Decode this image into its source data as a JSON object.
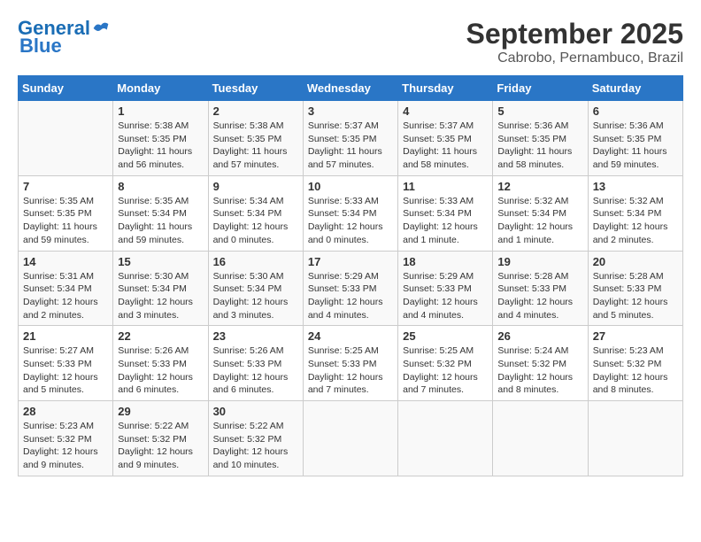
{
  "logo": {
    "line1": "General",
    "line2": "Blue"
  },
  "title": "September 2025",
  "subtitle": "Cabrobo, Pernambuco, Brazil",
  "weekdays": [
    "Sunday",
    "Monday",
    "Tuesday",
    "Wednesday",
    "Thursday",
    "Friday",
    "Saturday"
  ],
  "weeks": [
    [
      {
        "day": "",
        "info": ""
      },
      {
        "day": "1",
        "info": "Sunrise: 5:38 AM\nSunset: 5:35 PM\nDaylight: 11 hours\nand 56 minutes."
      },
      {
        "day": "2",
        "info": "Sunrise: 5:38 AM\nSunset: 5:35 PM\nDaylight: 11 hours\nand 57 minutes."
      },
      {
        "day": "3",
        "info": "Sunrise: 5:37 AM\nSunset: 5:35 PM\nDaylight: 11 hours\nand 57 minutes."
      },
      {
        "day": "4",
        "info": "Sunrise: 5:37 AM\nSunset: 5:35 PM\nDaylight: 11 hours\nand 58 minutes."
      },
      {
        "day": "5",
        "info": "Sunrise: 5:36 AM\nSunset: 5:35 PM\nDaylight: 11 hours\nand 58 minutes."
      },
      {
        "day": "6",
        "info": "Sunrise: 5:36 AM\nSunset: 5:35 PM\nDaylight: 11 hours\nand 59 minutes."
      }
    ],
    [
      {
        "day": "7",
        "info": "Sunrise: 5:35 AM\nSunset: 5:35 PM\nDaylight: 11 hours\nand 59 minutes."
      },
      {
        "day": "8",
        "info": "Sunrise: 5:35 AM\nSunset: 5:34 PM\nDaylight: 11 hours\nand 59 minutes."
      },
      {
        "day": "9",
        "info": "Sunrise: 5:34 AM\nSunset: 5:34 PM\nDaylight: 12 hours\nand 0 minutes."
      },
      {
        "day": "10",
        "info": "Sunrise: 5:33 AM\nSunset: 5:34 PM\nDaylight: 12 hours\nand 0 minutes."
      },
      {
        "day": "11",
        "info": "Sunrise: 5:33 AM\nSunset: 5:34 PM\nDaylight: 12 hours\nand 1 minute."
      },
      {
        "day": "12",
        "info": "Sunrise: 5:32 AM\nSunset: 5:34 PM\nDaylight: 12 hours\nand 1 minute."
      },
      {
        "day": "13",
        "info": "Sunrise: 5:32 AM\nSunset: 5:34 PM\nDaylight: 12 hours\nand 2 minutes."
      }
    ],
    [
      {
        "day": "14",
        "info": "Sunrise: 5:31 AM\nSunset: 5:34 PM\nDaylight: 12 hours\nand 2 minutes."
      },
      {
        "day": "15",
        "info": "Sunrise: 5:30 AM\nSunset: 5:34 PM\nDaylight: 12 hours\nand 3 minutes."
      },
      {
        "day": "16",
        "info": "Sunrise: 5:30 AM\nSunset: 5:34 PM\nDaylight: 12 hours\nand 3 minutes."
      },
      {
        "day": "17",
        "info": "Sunrise: 5:29 AM\nSunset: 5:33 PM\nDaylight: 12 hours\nand 4 minutes."
      },
      {
        "day": "18",
        "info": "Sunrise: 5:29 AM\nSunset: 5:33 PM\nDaylight: 12 hours\nand 4 minutes."
      },
      {
        "day": "19",
        "info": "Sunrise: 5:28 AM\nSunset: 5:33 PM\nDaylight: 12 hours\nand 4 minutes."
      },
      {
        "day": "20",
        "info": "Sunrise: 5:28 AM\nSunset: 5:33 PM\nDaylight: 12 hours\nand 5 minutes."
      }
    ],
    [
      {
        "day": "21",
        "info": "Sunrise: 5:27 AM\nSunset: 5:33 PM\nDaylight: 12 hours\nand 5 minutes."
      },
      {
        "day": "22",
        "info": "Sunrise: 5:26 AM\nSunset: 5:33 PM\nDaylight: 12 hours\nand 6 minutes."
      },
      {
        "day": "23",
        "info": "Sunrise: 5:26 AM\nSunset: 5:33 PM\nDaylight: 12 hours\nand 6 minutes."
      },
      {
        "day": "24",
        "info": "Sunrise: 5:25 AM\nSunset: 5:33 PM\nDaylight: 12 hours\nand 7 minutes."
      },
      {
        "day": "25",
        "info": "Sunrise: 5:25 AM\nSunset: 5:32 PM\nDaylight: 12 hours\nand 7 minutes."
      },
      {
        "day": "26",
        "info": "Sunrise: 5:24 AM\nSunset: 5:32 PM\nDaylight: 12 hours\nand 8 minutes."
      },
      {
        "day": "27",
        "info": "Sunrise: 5:23 AM\nSunset: 5:32 PM\nDaylight: 12 hours\nand 8 minutes."
      }
    ],
    [
      {
        "day": "28",
        "info": "Sunrise: 5:23 AM\nSunset: 5:32 PM\nDaylight: 12 hours\nand 9 minutes."
      },
      {
        "day": "29",
        "info": "Sunrise: 5:22 AM\nSunset: 5:32 PM\nDaylight: 12 hours\nand 9 minutes."
      },
      {
        "day": "30",
        "info": "Sunrise: 5:22 AM\nSunset: 5:32 PM\nDaylight: 12 hours\nand 10 minutes."
      },
      {
        "day": "",
        "info": ""
      },
      {
        "day": "",
        "info": ""
      },
      {
        "day": "",
        "info": ""
      },
      {
        "day": "",
        "info": ""
      }
    ]
  ]
}
